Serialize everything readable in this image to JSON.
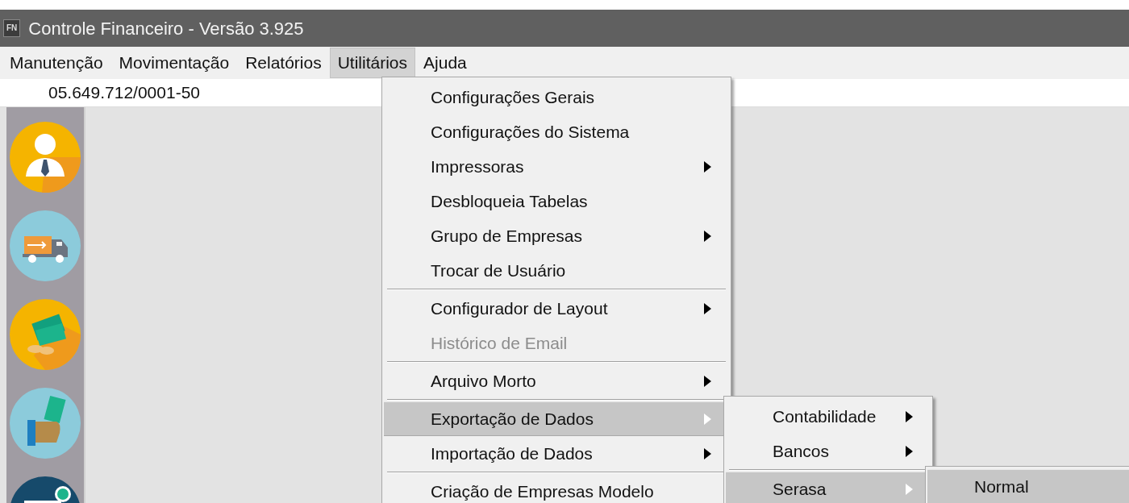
{
  "window": {
    "icon_text": "FN",
    "title": "Controle Financeiro - Versão 3.925"
  },
  "menu_bar": [
    {
      "label": "Manutenção",
      "selected": false
    },
    {
      "label": "Movimentação",
      "selected": false
    },
    {
      "label": "Relatórios",
      "selected": false
    },
    {
      "label": "Utilitários",
      "selected": true
    },
    {
      "label": "Ajuda",
      "selected": false
    }
  ],
  "company_field": {
    "value": "05.649.712/0001-50"
  },
  "dropdown": {
    "items": [
      {
        "kind": "item",
        "label": "Configurações Gerais",
        "submenu": false,
        "disabled": false,
        "selected": false
      },
      {
        "kind": "item",
        "label": "Configurações do Sistema",
        "submenu": false,
        "disabled": false,
        "selected": false
      },
      {
        "kind": "item",
        "label": "Impressoras",
        "submenu": true,
        "disabled": false,
        "selected": false
      },
      {
        "kind": "item",
        "label": "Desbloqueia Tabelas",
        "submenu": false,
        "disabled": false,
        "selected": false
      },
      {
        "kind": "item",
        "label": "Grupo de Empresas",
        "submenu": true,
        "disabled": false,
        "selected": false
      },
      {
        "kind": "item",
        "label": "Trocar de Usuário",
        "submenu": false,
        "disabled": false,
        "selected": false
      },
      {
        "kind": "separator"
      },
      {
        "kind": "item",
        "label": "Configurador de Layout",
        "submenu": true,
        "disabled": false,
        "selected": false
      },
      {
        "kind": "item",
        "label": "Histórico de Email",
        "submenu": false,
        "disabled": true,
        "selected": false
      },
      {
        "kind": "separator"
      },
      {
        "kind": "item",
        "label": "Arquivo Morto",
        "submenu": true,
        "disabled": false,
        "selected": false
      },
      {
        "kind": "separator"
      },
      {
        "kind": "item",
        "label": "Exportação de Dados",
        "submenu": true,
        "disabled": false,
        "selected": true,
        "children": [
          {
            "kind": "item",
            "label": "Contabilidade",
            "submenu": true,
            "disabled": false,
            "selected": false
          },
          {
            "kind": "item",
            "label": "Bancos",
            "submenu": true,
            "disabled": false,
            "selected": false
          },
          {
            "kind": "separator"
          },
          {
            "kind": "item",
            "label": "Serasa",
            "submenu": true,
            "disabled": false,
            "selected": true,
            "children": [
              {
                "kind": "item",
                "label": "Normal",
                "submenu": false,
                "disabled": false,
                "selected": true
              }
            ]
          }
        ]
      },
      {
        "kind": "item",
        "label": "Importação de Dados",
        "submenu": true,
        "disabled": false,
        "selected": false
      },
      {
        "kind": "separator"
      },
      {
        "kind": "item",
        "label": "Criação de Empresas Modelo",
        "submenu": false,
        "disabled": false,
        "selected": false
      }
    ]
  }
}
